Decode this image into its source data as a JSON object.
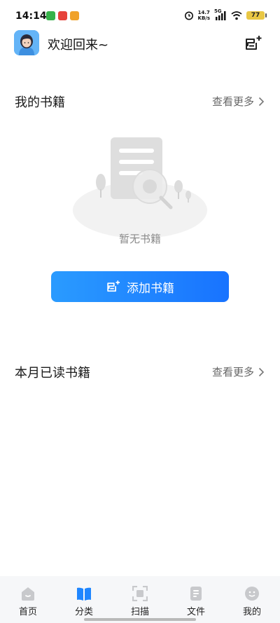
{
  "status_bar": {
    "time": "14:14",
    "net_speed_value": "14.7",
    "net_speed_unit": "KB/s",
    "network": "5G",
    "battery": "77"
  },
  "header": {
    "welcome": "欢迎回来~"
  },
  "my_books": {
    "title": "我的书籍",
    "more": "查看更多",
    "empty_text": "暂无书籍",
    "add_button": "添加书籍"
  },
  "monthly": {
    "title": "本月已读书籍",
    "more": "查看更多"
  },
  "nav": {
    "items": [
      {
        "label": "首页",
        "icon": "home-icon"
      },
      {
        "label": "分类",
        "icon": "category-icon"
      },
      {
        "label": "扫描",
        "icon": "scan-icon"
      },
      {
        "label": "文件",
        "icon": "file-icon"
      },
      {
        "label": "我的",
        "icon": "profile-icon"
      }
    ]
  },
  "colors": {
    "accent": "#1f86ff",
    "nav_background": "#f6f7f9"
  }
}
